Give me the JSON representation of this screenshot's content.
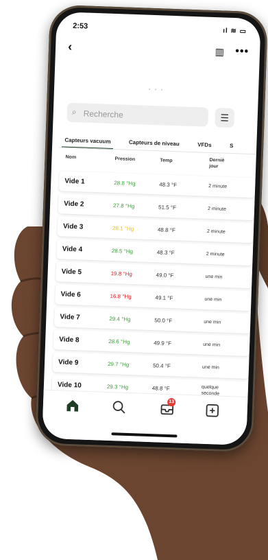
{
  "status_bar": {
    "time": "2:53",
    "system_icons": "ıl ≋ ▭"
  },
  "nav": {
    "back_icon": "chevron-left-icon",
    "map_icon": "map-icon",
    "more_icon": "more-icon"
  },
  "loader": "• • •",
  "search": {
    "placeholder": "Recherche",
    "value": ""
  },
  "tabs": [
    "Capteurs vacuum",
    "Capteurs de niveau",
    "VFDs",
    "S"
  ],
  "table": {
    "headers": {
      "name": "Nom",
      "pressure": "Pression",
      "temp": "Temp",
      "last_day_1": "Derniè",
      "last_day_2": "jour"
    },
    "rows": [
      {
        "name": "Vide 1",
        "pressure": "28.8 °Hg",
        "pressure_color": "#3f9f3f",
        "temp": "48.3 °F",
        "last": "2 minute"
      },
      {
        "name": "Vide 2",
        "pressure": "27.8 °Hg",
        "pressure_color": "#3f9f3f",
        "temp": "51.5 °F",
        "last": "2 minute"
      },
      {
        "name": "Vide 3",
        "pressure": "28.1 °Hg",
        "pressure_color": "#f2c200",
        "temp": "48.8 °F",
        "last": "2 minute"
      },
      {
        "name": "Vide 4",
        "pressure": "28.5 °Hg",
        "pressure_color": "#3f9f3f",
        "temp": "48.3 °F",
        "last": "2 minute"
      },
      {
        "name": "Vide 5",
        "pressure": "19.8 °Hg",
        "pressure_color": "#e02020",
        "temp": "49.0 °F",
        "last": "une min"
      },
      {
        "name": "Vide 6",
        "pressure": "16.8 °Hg",
        "pressure_color": "#e02020",
        "temp": "49.1 °F",
        "last": "une min"
      },
      {
        "name": "Vide 7",
        "pressure": "29.4 °Hg",
        "pressure_color": "#3f9f3f",
        "temp": "50.0 °F",
        "last": "une min"
      },
      {
        "name": "Vide 8",
        "pressure": "28.6 °Hg",
        "pressure_color": "#3f9f3f",
        "temp": "49.9 °F",
        "last": "une min"
      },
      {
        "name": "Vide 9",
        "pressure": "29.7 °Hg",
        "pressure_color": "#3f9f3f",
        "temp": "50.4 °F",
        "last": "une min"
      },
      {
        "name": "Vide 10",
        "pressure": "29.3 °Hg",
        "pressure_color": "#3f9f3f",
        "temp": "48.8 °F",
        "last": "quelque",
        "last_2": "seconde"
      }
    ]
  },
  "tabbar": {
    "items": [
      "home-icon",
      "search-icon",
      "inbox-icon",
      "add-icon"
    ],
    "badge": "13"
  },
  "colors": {
    "accent": "#1f3d25",
    "good": "#3f9f3f",
    "warn": "#f2c200",
    "bad": "#e02020"
  }
}
